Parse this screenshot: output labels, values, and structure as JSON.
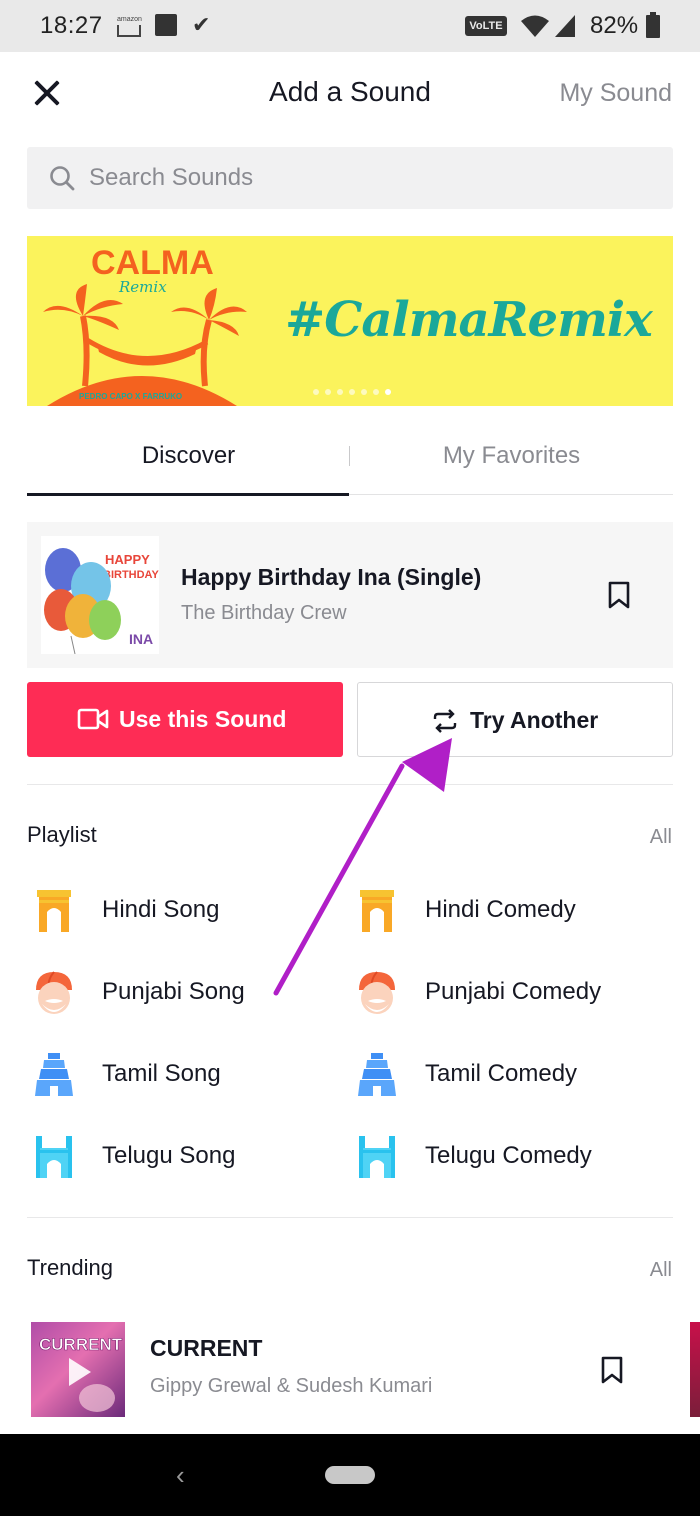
{
  "status_bar": {
    "time": "18:27",
    "amazon_label": "amazon",
    "volte": "VoLTE",
    "battery": "82%",
    "icons": [
      "amazon-icon",
      "image-icon",
      "check-icon",
      "volte-icon",
      "wifi-icon",
      "signal-icon",
      "battery-icon"
    ]
  },
  "header": {
    "title": "Add a Sound",
    "my_sound": "My Sound"
  },
  "search": {
    "placeholder": "Search Sounds",
    "value": ""
  },
  "banner": {
    "logo_title": "CALMA",
    "logo_subtitle": "Remix",
    "logo_credit": "PEDRO CAPO X FARRUKO",
    "tagline": "#CalmaRemix",
    "slide_count": 7,
    "active_slide": 7,
    "colors": {
      "background": "#fbf35c",
      "tagline": "#1aa89a",
      "logo": "#f4621f"
    }
  },
  "tabs": [
    {
      "label": "Discover",
      "active": true
    },
    {
      "label": "My Favorites",
      "active": false
    }
  ],
  "selected_sound": {
    "title": "Happy Birthday Ina (Single)",
    "artist": "The Birthday Crew",
    "cover_text_line1": "HAPPY",
    "cover_text_line2": "BIRTHDAY",
    "cover_text_name": "INA"
  },
  "actions": {
    "use_label": "Use this Sound",
    "try_label": "Try Another",
    "accent": "#fe2c55"
  },
  "playlist": {
    "title": "Playlist",
    "all_label": "All",
    "items": [
      {
        "label": "Hindi Song",
        "icon": "india-gate-icon"
      },
      {
        "label": "Hindi Comedy",
        "icon": "india-gate-icon"
      },
      {
        "label": "Punjabi Song",
        "icon": "turban-face-icon"
      },
      {
        "label": "Punjabi Comedy",
        "icon": "turban-face-icon"
      },
      {
        "label": "Tamil Song",
        "icon": "temple-gopuram-icon"
      },
      {
        "label": "Tamil Comedy",
        "icon": "temple-gopuram-icon"
      },
      {
        "label": "Telugu Song",
        "icon": "charminar-icon"
      },
      {
        "label": "Telugu Comedy",
        "icon": "charminar-icon"
      }
    ]
  },
  "trending": {
    "title": "Trending",
    "all_label": "All",
    "items": [
      {
        "title": "CURRENT",
        "artist": "Gippy Grewal & Sudesh Kumari",
        "cover_text": "CURRENT"
      }
    ]
  },
  "annotation": {
    "type": "arrow",
    "color": "#b01fc7",
    "points_to": "Try Another"
  }
}
